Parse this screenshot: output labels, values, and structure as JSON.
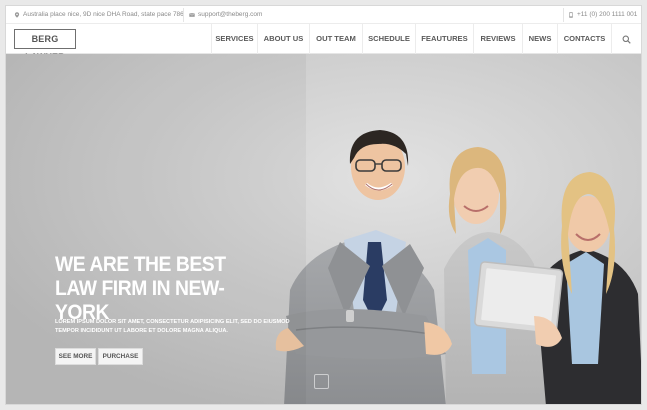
{
  "topbar": {
    "address": "Australia place nice, 9D nice DHA Road, state pace 786",
    "email": "support@theberg.com",
    "phone": "+11 (0) 200 1111 001"
  },
  "header": {
    "logo": "BERG LAWYER",
    "nav": [
      "SERVICES",
      "ABOUT US",
      "OUT TEAM",
      "SCHEDULE",
      "FEAUTURES",
      "REVIEWS",
      "NEWS",
      "CONTACTS"
    ]
  },
  "hero": {
    "title": "WE ARE THE BEST LAW FIRM IN NEW-YORK",
    "subtitle": "LOREM IPSUM DOLOR SIT AMET, CONSECTETUR ADIPISICING ELIT, SED DO EIUSMOD TEMPOR INCIDIDUNT UT LABORE ET DOLORE MAGNA ALIQUA.",
    "buttons": [
      "SEE MORE",
      "PURCHASE"
    ]
  },
  "icons": {
    "address": "map-pin-icon",
    "email": "envelope-icon",
    "phone": "phone-icon",
    "search": "search-icon"
  },
  "colors": {
    "hero_background": "#cccccc",
    "text_white": "#ffffff",
    "nav_text": "#5a5a5a"
  }
}
